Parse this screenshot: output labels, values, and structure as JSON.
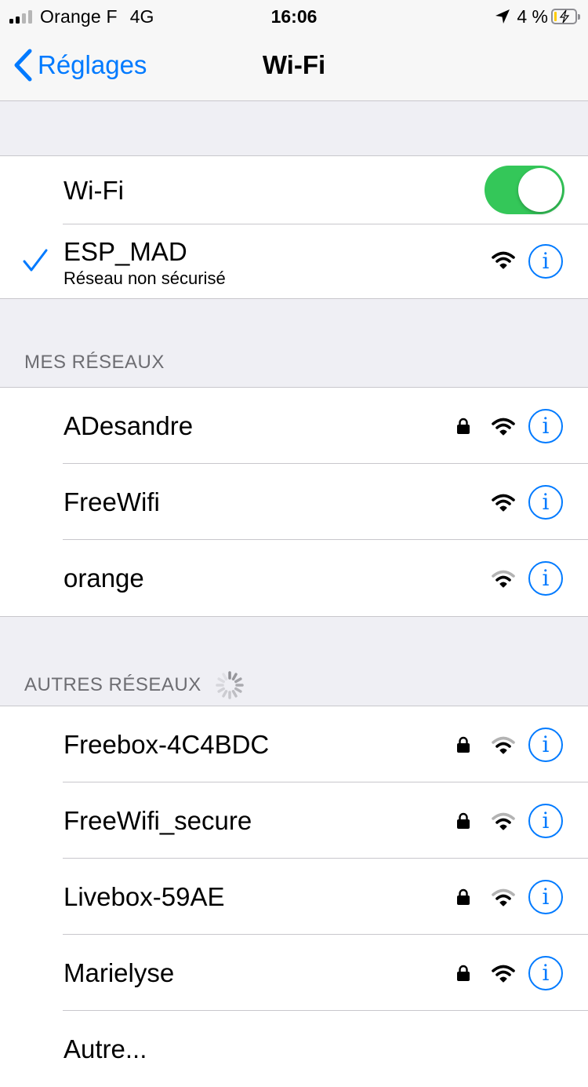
{
  "status_bar": {
    "carrier": "Orange F",
    "network": "4G",
    "time": "16:06",
    "battery_percent": "4 %",
    "battery_level": 0.04,
    "signal_bars": 2
  },
  "nav": {
    "back_label": "Réglages",
    "title": "Wi-Fi"
  },
  "wifi_toggle": {
    "label": "Wi-Fi",
    "on": true
  },
  "connected": {
    "name": "ESP_MAD",
    "subtitle": "Réseau non sécurisé"
  },
  "my_networks": {
    "header": "MES RÉSEAUX",
    "items": [
      {
        "name": "ADesandre",
        "secured": true,
        "signal": "strong"
      },
      {
        "name": "FreeWifi",
        "secured": false,
        "signal": "strong"
      },
      {
        "name": "orange",
        "secured": false,
        "signal": "weak"
      }
    ]
  },
  "other_networks": {
    "header": "AUTRES RÉSEAUX",
    "items": [
      {
        "name": "Freebox-4C4BDC",
        "secured": true,
        "signal": "weak"
      },
      {
        "name": "FreeWifi_secure",
        "secured": true,
        "signal": "weak"
      },
      {
        "name": "Livebox-59AE",
        "secured": true,
        "signal": "weak"
      },
      {
        "name": "Marielyse",
        "secured": true,
        "signal": "strong"
      },
      {
        "name": "Autre..."
      }
    ]
  },
  "colors": {
    "accent": "#007aff",
    "toggle_on": "#34c759",
    "battery_low": "#ffcc00"
  },
  "icons": {
    "info": "i"
  }
}
